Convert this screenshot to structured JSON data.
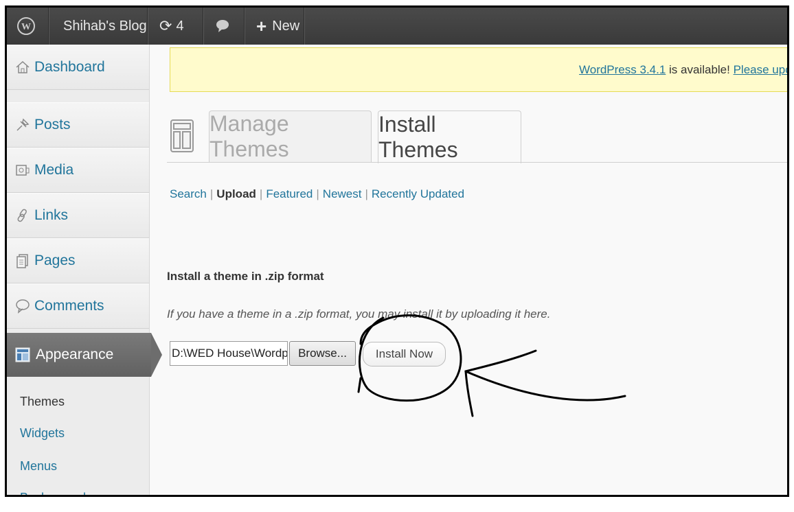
{
  "adminbar": {
    "site_name": "Shihab's Blog",
    "updates_count": "4",
    "new_label": "New"
  },
  "sidebar": {
    "items": [
      {
        "label": "Dashboard"
      },
      {
        "label": "Posts"
      },
      {
        "label": "Media"
      },
      {
        "label": "Links"
      },
      {
        "label": "Pages"
      },
      {
        "label": "Comments"
      }
    ],
    "active": {
      "label": "Appearance"
    },
    "submenu": [
      "Themes",
      "Widgets",
      "Menus",
      "Background"
    ]
  },
  "update_nag": {
    "version_link": "WordPress 3.4.1",
    "text": " is available! ",
    "action_link": "Please upc"
  },
  "tabs": {
    "manage": "Manage Themes",
    "install": "Install Themes"
  },
  "subnav": {
    "search": "Search",
    "upload": "Upload",
    "featured": "Featured",
    "newest": "Newest",
    "recent": "Recently Updated",
    "separator": "|"
  },
  "upload": {
    "title": "Install a theme in .zip format",
    "description": "If you have a theme in a .zip format, you may install it by uploading it here.",
    "file_value": "D:\\WED House\\Wordp",
    "browse_label": "Browse...",
    "install_label": "Install Now"
  },
  "colors": {
    "link": "#21759b",
    "adminbar": "#464646",
    "nag_bg": "#fffbcc",
    "active_menu": "#6d6d6d"
  }
}
